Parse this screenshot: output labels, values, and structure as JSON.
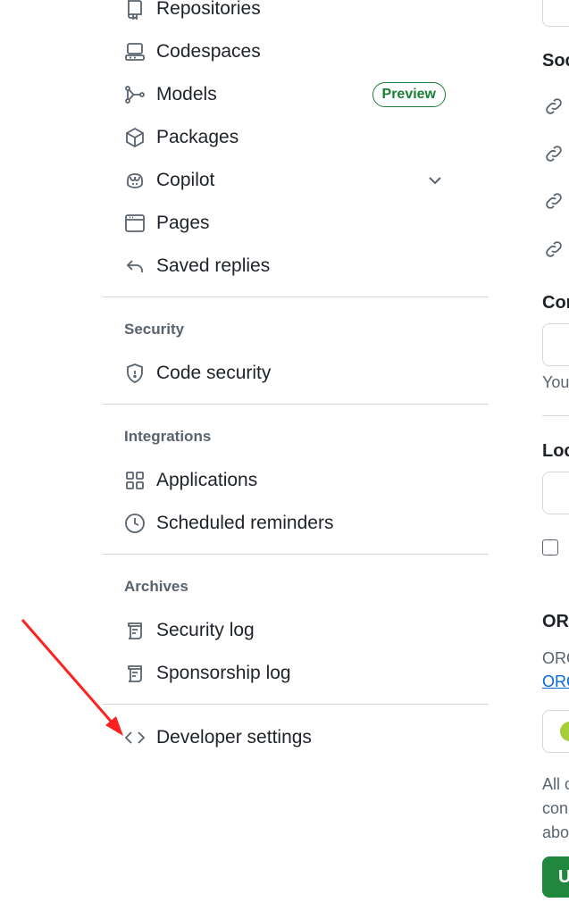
{
  "sidebar": {
    "items_top": [
      {
        "label": "Repositories",
        "icon": "repo-icon"
      },
      {
        "label": "Codespaces",
        "icon": "codespaces-icon"
      },
      {
        "label": "Models",
        "icon": "models-icon",
        "badge": "Preview"
      },
      {
        "label": "Packages",
        "icon": "package-icon"
      },
      {
        "label": "Copilot",
        "icon": "copilot-icon",
        "expandable": true
      },
      {
        "label": "Pages",
        "icon": "browser-icon"
      },
      {
        "label": "Saved replies",
        "icon": "reply-icon"
      }
    ],
    "security": {
      "title": "Security",
      "items": [
        {
          "label": "Code security",
          "icon": "shield-icon"
        }
      ]
    },
    "integrations": {
      "title": "Integrations",
      "items": [
        {
          "label": "Applications",
          "icon": "apps-icon"
        },
        {
          "label": "Scheduled reminders",
          "icon": "clock-icon"
        }
      ]
    },
    "archives": {
      "title": "Archives",
      "items": [
        {
          "label": "Security log",
          "icon": "log-icon"
        },
        {
          "label": "Sponsorship log",
          "icon": "log-icon"
        }
      ]
    },
    "developer": {
      "label": "Developer settings",
      "icon": "code-icon"
    }
  },
  "right_pane": {
    "social_heading": "Soc",
    "company_heading": "Cor",
    "company_note": "You",
    "location_heading": "Loc",
    "orcid_heading": "ORC",
    "orcid_text": "ORC",
    "orcid_link": "ORC",
    "all_text": [
      "All c",
      "con",
      "abo"
    ],
    "button_label": "U"
  },
  "annotation": {
    "color": "#ff2020"
  }
}
